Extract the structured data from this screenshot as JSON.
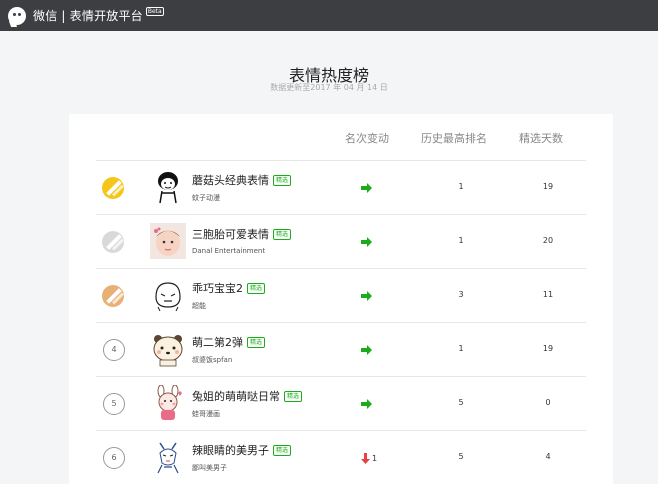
{
  "header": {
    "brand": "微信 | 表情开放平台",
    "beta": "Beta",
    "logo_icon": "wechat-logo-icon",
    "bg_color": "#3d3e42"
  },
  "page": {
    "title": "表情热度榜",
    "update_text": "数据更新至2017 年 04 月 14 日"
  },
  "table": {
    "columns": [
      "名次变动",
      "历史最高排名",
      "精选天数"
    ],
    "tag_label": "精选",
    "rows": [
      {
        "rank": "1",
        "medal": "gold",
        "name": "蘑菇头经典表情",
        "author": "蚊子动漫",
        "change": "up",
        "change_value": "",
        "history_best": "1",
        "days": "19"
      },
      {
        "rank": "2",
        "medal": "silver",
        "name": "三胞胎可爱表情",
        "author": "Danal Entertainment",
        "change": "up",
        "change_value": "",
        "history_best": "1",
        "days": "20"
      },
      {
        "rank": "3",
        "medal": "bronze",
        "name": "乖巧宝宝2",
        "author": "超能",
        "change": "up",
        "change_value": "",
        "history_best": "3",
        "days": "11"
      },
      {
        "rank": "4",
        "medal": "none",
        "name": "萌二第2弹",
        "author": "叔婆饭spfan",
        "change": "up",
        "change_value": "",
        "history_best": "1",
        "days": "19"
      },
      {
        "rank": "5",
        "medal": "none",
        "name": "兔姐的萌萌哒日常",
        "author": "蛙哥漫画",
        "change": "up",
        "change_value": "",
        "history_best": "5",
        "days": "0"
      },
      {
        "rank": "6",
        "medal": "none",
        "name": "辣眼睛的美男子",
        "author": "鄙叫美男子",
        "change": "down",
        "change_value": "1",
        "history_best": "5",
        "days": "4"
      }
    ]
  },
  "colors": {
    "gold": "#f5c518",
    "silver": "#d9d9d9",
    "bronze": "#e8b074",
    "up_arrow": "#1aad19",
    "down_arrow": "#e64340"
  }
}
